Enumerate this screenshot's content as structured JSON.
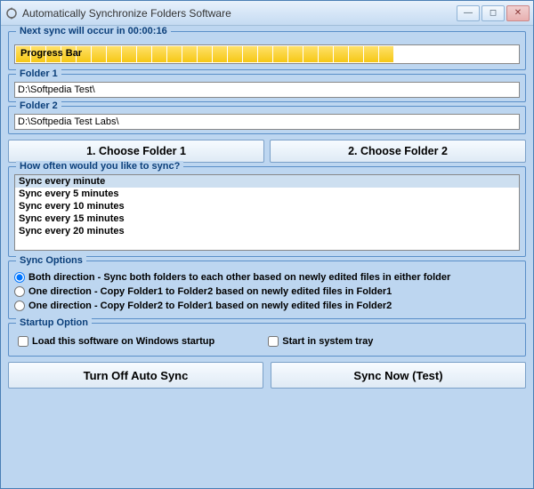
{
  "window": {
    "title": "Automatically Synchronize Folders Software"
  },
  "countdown": {
    "label_prefix": "Next sync will occur in ",
    "time": "00:00:16",
    "progress_label": "Progress Bar",
    "filled_blocks": 25,
    "total_blocks": 33
  },
  "folder1": {
    "legend": "Folder 1",
    "path": "D:\\Softpedia Test\\"
  },
  "folder2": {
    "legend": "Folder 2",
    "path": "D:\\Softpedia Test Labs\\"
  },
  "choose_buttons": {
    "folder1": "1. Choose Folder 1",
    "folder2": "2. Choose Folder 2"
  },
  "interval": {
    "legend": "How often would you like to sync?",
    "options": [
      "Sync every minute",
      "Sync every 5 minutes",
      "Sync every 10 minutes",
      "Sync every 15 minutes",
      "Sync every 20 minutes"
    ],
    "selected_index": 0
  },
  "sync_options": {
    "legend": "Sync Options",
    "options": [
      "Both direction - Sync both folders to each other based on newly edited files in either folder",
      "One direction - Copy Folder1 to Folder2 based on newly edited files in Folder1",
      "One direction - Copy Folder2 to Folder1 based on newly edited files in Folder2"
    ],
    "selected_index": 0
  },
  "startup": {
    "legend": "Startup Option",
    "load_on_startup_label": "Load this software on Windows startup",
    "load_on_startup_checked": false,
    "start_in_tray_label": "Start in system tray",
    "start_in_tray_checked": false
  },
  "bottom_buttons": {
    "turn_off": "Turn Off Auto Sync",
    "sync_now": "Sync Now (Test)"
  }
}
